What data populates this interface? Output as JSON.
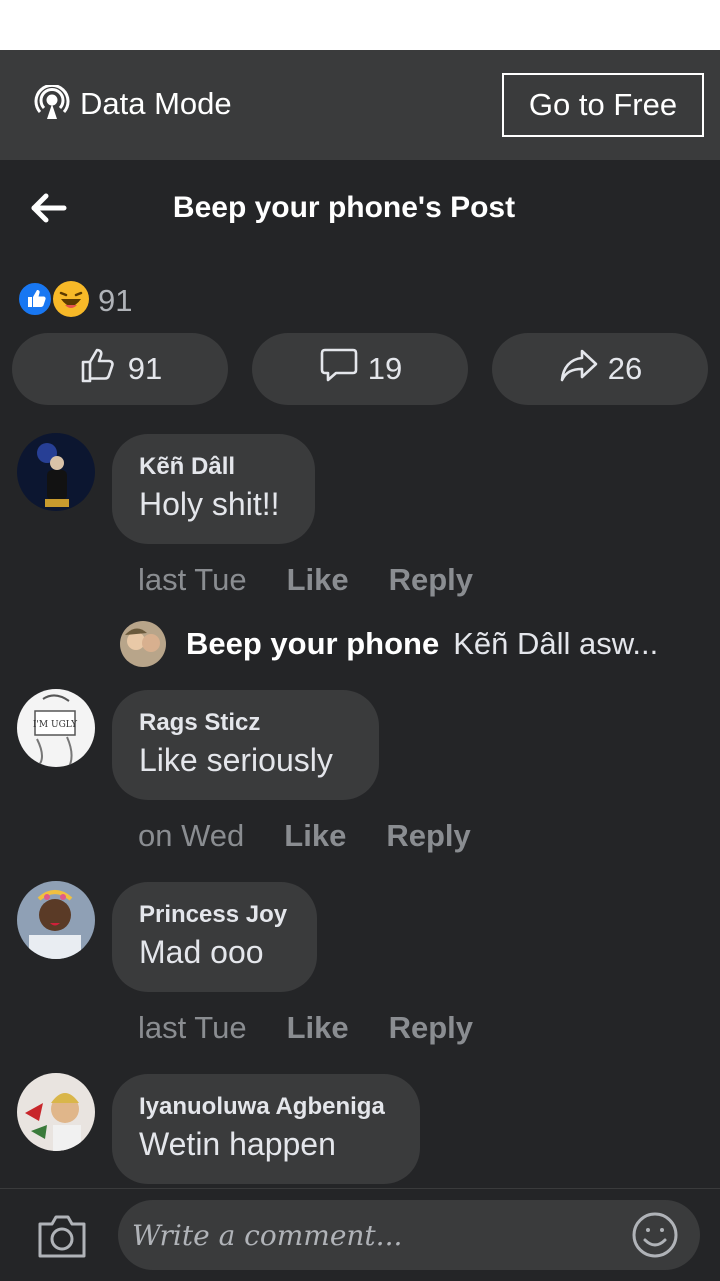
{
  "data_bar": {
    "label": "Data Mode",
    "button": "Go to Free"
  },
  "header": {
    "title": "Beep your phone's Post"
  },
  "reactions": {
    "count": "91"
  },
  "actions": {
    "like_count": "91",
    "comment_count": "19",
    "share_count": "26"
  },
  "comments": [
    {
      "name": "Kẽñ Dâll",
      "text": "Holy shit!!",
      "time": "last Tue",
      "like": "Like",
      "reply": "Reply"
    },
    {
      "name": "Rags Sticz",
      "text": "Like seriously",
      "time": "on Wed",
      "like": "Like",
      "reply": "Reply"
    },
    {
      "name": "Princess Joy",
      "text": "Mad ooo",
      "time": "last Tue",
      "like": "Like",
      "reply": "Reply"
    },
    {
      "name": "Iyanuoluwa Agbeniga",
      "text": "Wetin happen"
    }
  ],
  "reply_preview": {
    "name": "Beep your phone",
    "text": "Kẽñ Dâll asw..."
  },
  "composer": {
    "placeholder": "Write a comment..."
  },
  "colors": {
    "background": "#242527",
    "bubble": "#3a3b3c",
    "like_blue": "#1877f2",
    "haha_yellow": "#f7b928"
  }
}
